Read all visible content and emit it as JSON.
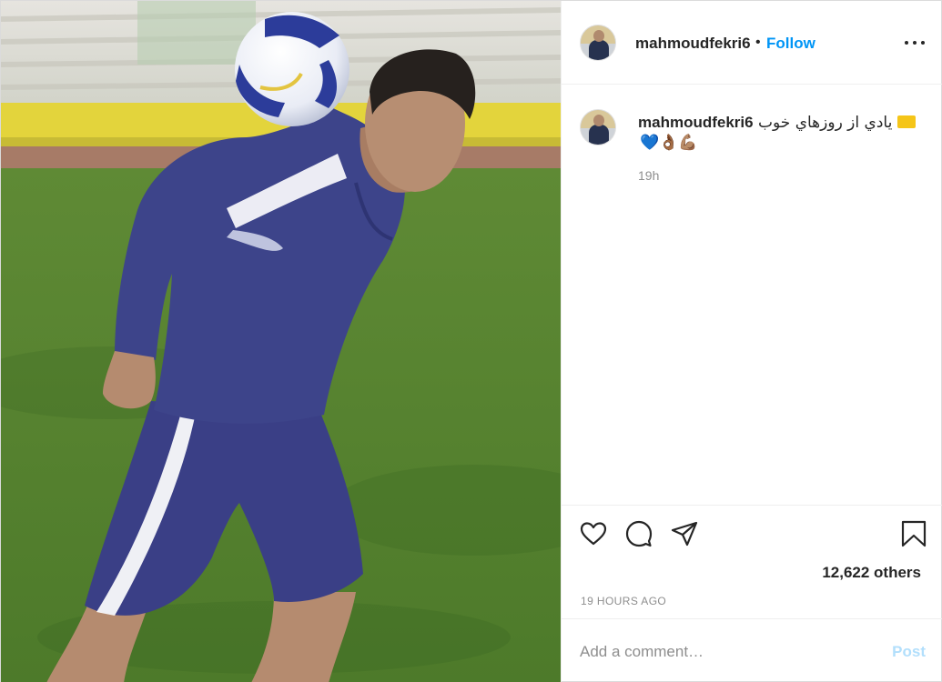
{
  "post": {
    "username": "mahmoudfekri6",
    "follow_label": "Follow",
    "separator": "•",
    "caption_text": "يادي از روزهاي خوب",
    "caption_emoji_line": "💙👌🏾💪🏽",
    "caption_time": "19h",
    "likes_text": "12,622 others",
    "time_ago": "19 HOURS AGO",
    "comment_placeholder": "Add a comment…",
    "post_label": "Post"
  },
  "icons": {
    "more": "more-options-icon",
    "like": "heart-icon",
    "comment": "comment-icon",
    "share": "share-icon",
    "save": "bookmark-icon"
  },
  "colors": {
    "link": "#0095f6",
    "post_disabled": "#b2dffc",
    "muted": "#8e8e8e",
    "text": "#262626"
  }
}
